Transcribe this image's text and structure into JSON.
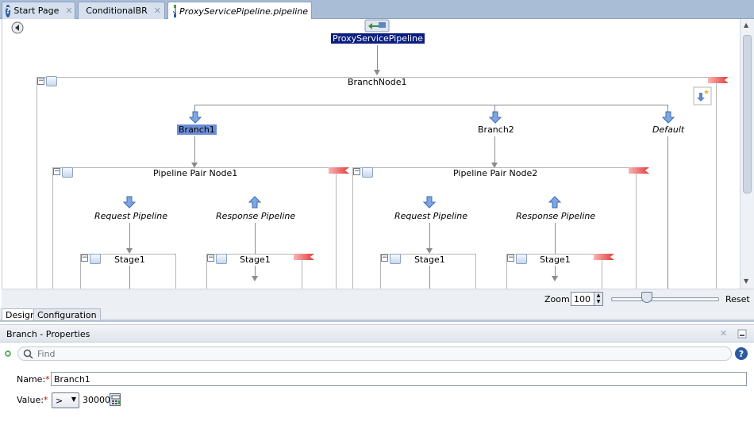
{
  "tabs": [
    {
      "label": "Start Page",
      "icon": "help-circle-icon"
    },
    {
      "label": "ConditionalBR",
      "icon": "pipeline-icon"
    },
    {
      "label": "ProxyServicePipeline.pipeline",
      "icon": "pipeline-file-icon"
    }
  ],
  "diagram": {
    "root": "ProxyServicePipeline",
    "branch_node": "BranchNode1",
    "branches": [
      "Branch1",
      "Branch2",
      "Default"
    ],
    "pipeline_pairs": [
      {
        "name": "Pipeline Pair Node1",
        "request": "Request Pipeline",
        "response": "Response Pipeline",
        "request_stage": "Stage1",
        "response_stage": "Stage1"
      },
      {
        "name": "Pipeline Pair Node2",
        "request": "Request Pipeline",
        "response": "Response Pipeline",
        "request_stage": "Stage1",
        "response_stage": "Stage1"
      }
    ]
  },
  "zoom": {
    "label": "Zoom:",
    "value": "100",
    "reset": "Reset"
  },
  "view_tabs": [
    "Design",
    "Configuration"
  ],
  "properties": {
    "title": "Branch - Properties",
    "find_placeholder": "Find",
    "name_label": "Name:",
    "name_value": "Branch1",
    "value_label": "Value:",
    "operator": ">",
    "value": "30000",
    "required_mark": "*"
  },
  "colors": {
    "selection": "#0b1f80",
    "branch_selection": "#6d8ed6",
    "error_flag": "#e43a3a"
  }
}
